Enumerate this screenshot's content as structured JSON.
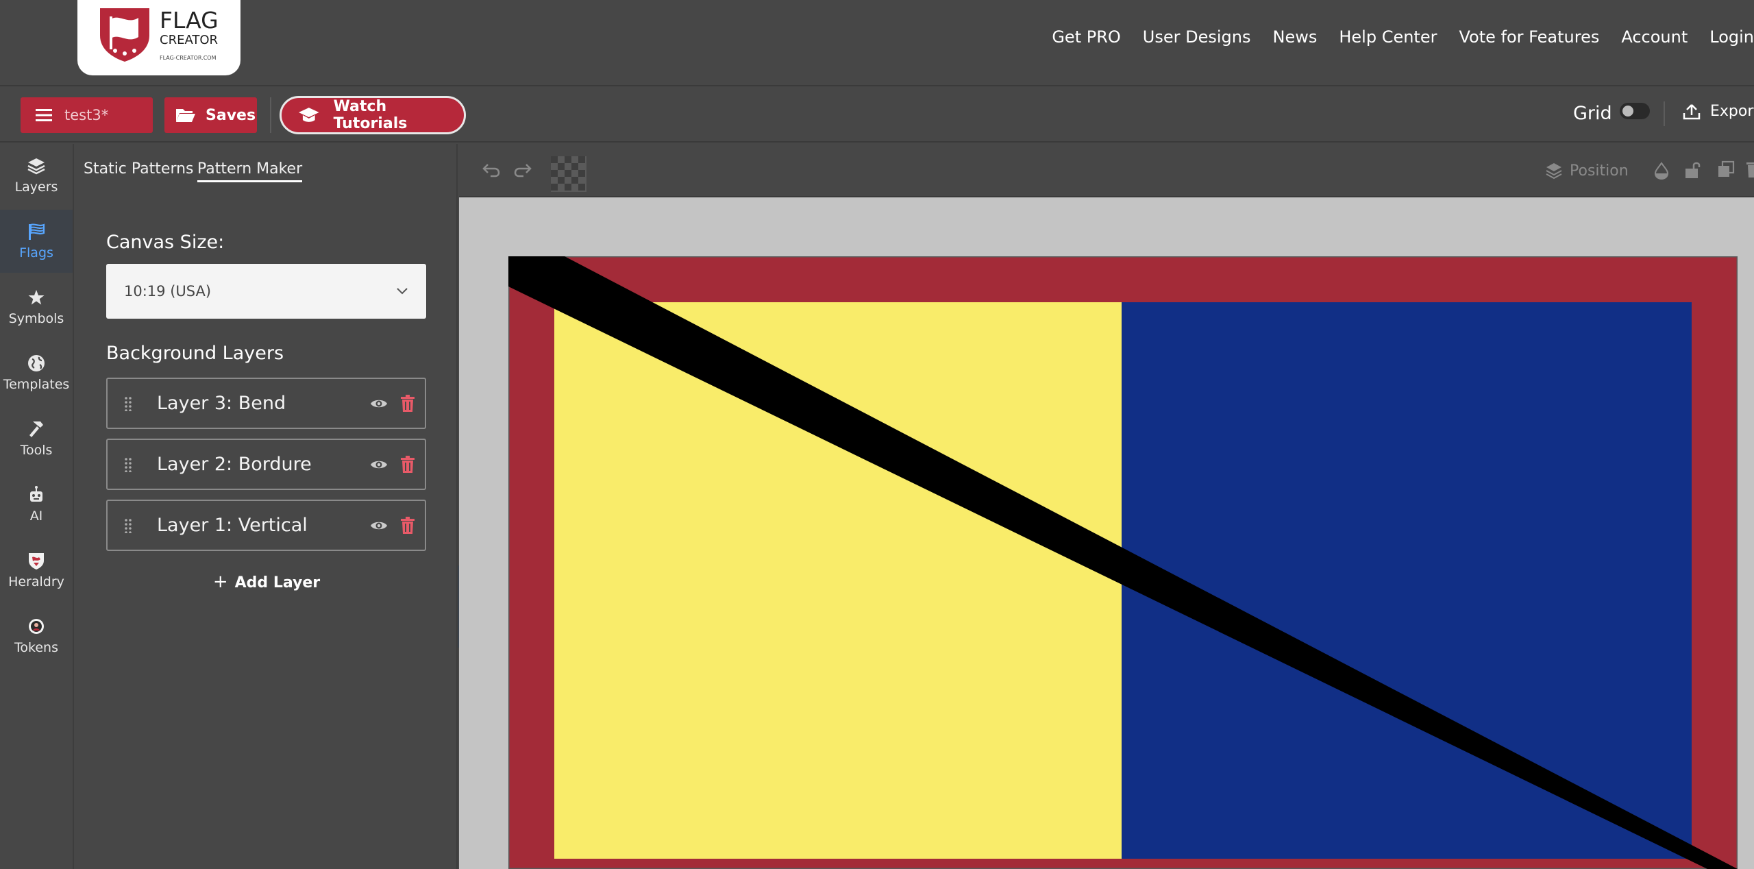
{
  "brand": {
    "logo_line1": "FLAG",
    "logo_line2": "CREATOR",
    "logo_line3": "FLAG-CREATOR.COM"
  },
  "nav": {
    "links": [
      "Get PRO",
      "User Designs",
      "News",
      "Help Center",
      "Vote for Features",
      "Account",
      "Login"
    ]
  },
  "toolbar": {
    "file_name": "test3*",
    "saves_label": "Saves",
    "tutorials_label": "Watch Tutorials",
    "grid_label": "Grid",
    "grid_enabled": false,
    "export_label": "Export"
  },
  "sidebar": {
    "items": [
      {
        "label": "Layers",
        "icon": "layers-icon"
      },
      {
        "label": "Flags",
        "icon": "flag-icon",
        "active": true
      },
      {
        "label": "Symbols",
        "icon": "star-icon"
      },
      {
        "label": "Templates",
        "icon": "globe-icon"
      },
      {
        "label": "Tools",
        "icon": "hammer-icon"
      },
      {
        "label": "AI",
        "icon": "robot-icon"
      },
      {
        "label": "Heraldry",
        "icon": "heraldry-icon"
      },
      {
        "label": "Tokens",
        "icon": "token-icon"
      }
    ]
  },
  "panel": {
    "tabs": [
      "Static Patterns",
      "Pattern Maker"
    ],
    "active_tab": "Pattern Maker",
    "canvas_size_label": "Canvas Size:",
    "canvas_size_value": "10:19 (USA)",
    "background_layers_label": "Background Layers",
    "layers": [
      {
        "name": "Layer 3: Bend"
      },
      {
        "name": "Layer 2: Bordure"
      },
      {
        "name": "Layer 1: Vertical"
      }
    ],
    "add_layer_label": "Add Layer"
  },
  "canvas_toolbar": {
    "position_label": "Position"
  },
  "flag": {
    "border_color": "#a32b38",
    "left_color": "#f9ec6a",
    "right_color": "#112f86",
    "bend_color": "#000000"
  }
}
